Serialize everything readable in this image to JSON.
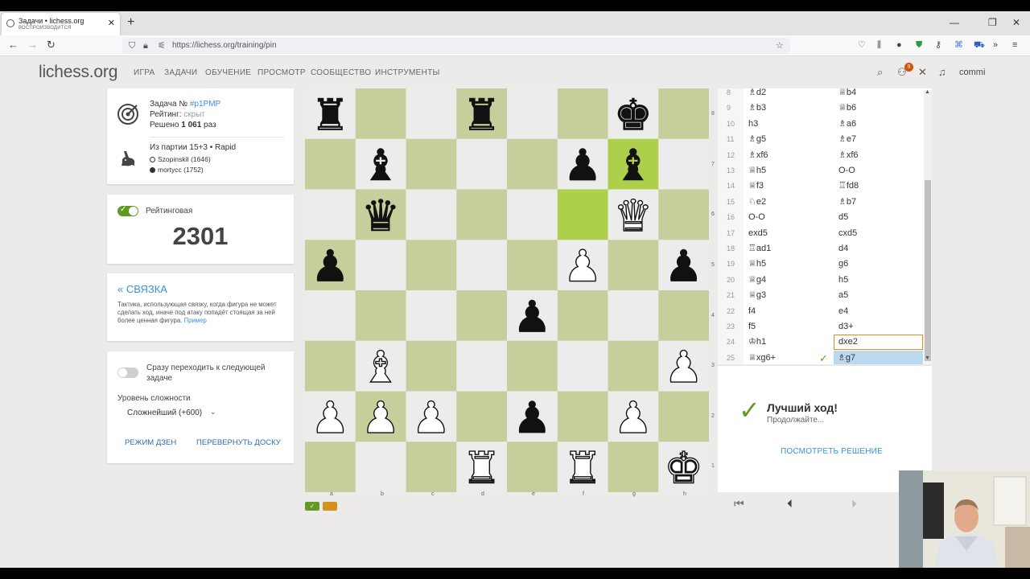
{
  "browser": {
    "tab_title": "Задачи • lichess.org",
    "tab_subtitle": "ВОСПРОИЗВОДИТСЯ",
    "url": "https://lichess.org/training/pin"
  },
  "site": {
    "logo": "lichess.org",
    "nav": [
      "ИГРА",
      "ЗАДАЧИ",
      "ОБУЧЕНИЕ",
      "ПРОСМОТР",
      "СООБЩЕСТВО",
      "ИНСТРУМЕНТЫ"
    ],
    "notification_count": "9",
    "username": "commi"
  },
  "puzzle": {
    "id_prefix": "Задача № ",
    "id_link": "#p1PMP",
    "rating_prefix": "Рейтинг: ",
    "rating_value": "скрыт",
    "solved_prefix": "Решено ",
    "solved_count": "1 061",
    "solved_suffix": " раз",
    "game_line": "Из партии 15+3 • Rapid",
    "player_white": "SzopinskiI (1646)",
    "player_black": "mortycc (1752)"
  },
  "rating_box": {
    "label": "Рейтинговая",
    "value": "2301",
    "color": "#629924"
  },
  "theme": {
    "back_link": "« СВЯЗКА",
    "desc": "Тактика, использующая связку, когда фигура не может сделать ход, иначе под атаку попадёт стоящая за ней более ценная фигура.",
    "example_link": "Пример"
  },
  "settings": {
    "autonext_label_line1": "Сразу переходить к следующей",
    "autonext_label_line2": "задаче",
    "difficulty_label": "Уровень сложности",
    "difficulty_value": "Сложнейший (+600)",
    "zen_button": "РЕЖИМ ДЗЕН",
    "flip_button": "ПЕРЕВЕРНУТЬ ДОСКУ"
  },
  "board": {
    "light_color": "#ececec",
    "dark_color": "#c6cf9b",
    "highlight_color": "#aecf4c",
    "files": [
      "a",
      "b",
      "c",
      "d",
      "e",
      "f",
      "g",
      "h"
    ],
    "ranks": [
      "8",
      "7",
      "6",
      "5",
      "4",
      "3",
      "2",
      "1"
    ],
    "pieces": [
      {
        "sq": "a8",
        "p": "r"
      },
      {
        "sq": "d8",
        "p": "r"
      },
      {
        "sq": "g8",
        "p": "k"
      },
      {
        "sq": "b7",
        "p": "b"
      },
      {
        "sq": "f7",
        "p": "p"
      },
      {
        "sq": "g7",
        "p": "b"
      },
      {
        "sq": "b6",
        "p": "q"
      },
      {
        "sq": "g6",
        "p": "Q"
      },
      {
        "sq": "a5",
        "p": "p"
      },
      {
        "sq": "f5",
        "p": "P"
      },
      {
        "sq": "h5",
        "p": "p"
      },
      {
        "sq": "e4",
        "p": "p"
      },
      {
        "sq": "b3",
        "p": "B"
      },
      {
        "sq": "h3",
        "p": "P"
      },
      {
        "sq": "a2",
        "p": "P"
      },
      {
        "sq": "b2",
        "p": "P"
      },
      {
        "sq": "c2",
        "p": "P"
      },
      {
        "sq": "e2",
        "p": "p"
      },
      {
        "sq": "g2",
        "p": "P"
      },
      {
        "sq": "d1",
        "p": "R"
      },
      {
        "sq": "f1",
        "p": "R"
      },
      {
        "sq": "h1",
        "p": "K"
      }
    ],
    "highlights": [
      "f6",
      "g7"
    ]
  },
  "moves": [
    {
      "n": "8",
      "w": "♗d2",
      "b": "♕b4"
    },
    {
      "n": "9",
      "w": "♗b3",
      "b": "♕b6"
    },
    {
      "n": "10",
      "w": "h3",
      "b": "♗a6"
    },
    {
      "n": "11",
      "w": "♗g5",
      "b": "♗e7"
    },
    {
      "n": "12",
      "w": "♗xf6",
      "b": "♗xf6"
    },
    {
      "n": "13",
      "w": "♕h5",
      "b": "O-O"
    },
    {
      "n": "14",
      "w": "♕f3",
      "b": "♖fd8"
    },
    {
      "n": "15",
      "w": "♘e2",
      "b": "♗b7"
    },
    {
      "n": "16",
      "w": "O-O",
      "b": "d5"
    },
    {
      "n": "17",
      "w": "exd5",
      "b": "cxd5"
    },
    {
      "n": "18",
      "w": "♖ad1",
      "b": "d4"
    },
    {
      "n": "19",
      "w": "♕h5",
      "b": "g6"
    },
    {
      "n": "20",
      "w": "♕g4",
      "b": "h5"
    },
    {
      "n": "21",
      "w": "♕g3",
      "b": "a5"
    },
    {
      "n": "22",
      "w": "f4",
      "b": "e4"
    },
    {
      "n": "23",
      "w": "f5",
      "b": "d3+"
    },
    {
      "n": "24",
      "w": "♔h1",
      "b": "dxe2"
    },
    {
      "n": "25",
      "w": "♕xg6+",
      "b": "♗g7"
    }
  ],
  "feedback": {
    "title": "Лучший ход!",
    "subtitle": "Продолжайте...",
    "solution_link": "ПОСМОТРЕТЬ РЕШЕНИЕ",
    "check_glyph": "✓",
    "move_check_glyph": "✓"
  }
}
